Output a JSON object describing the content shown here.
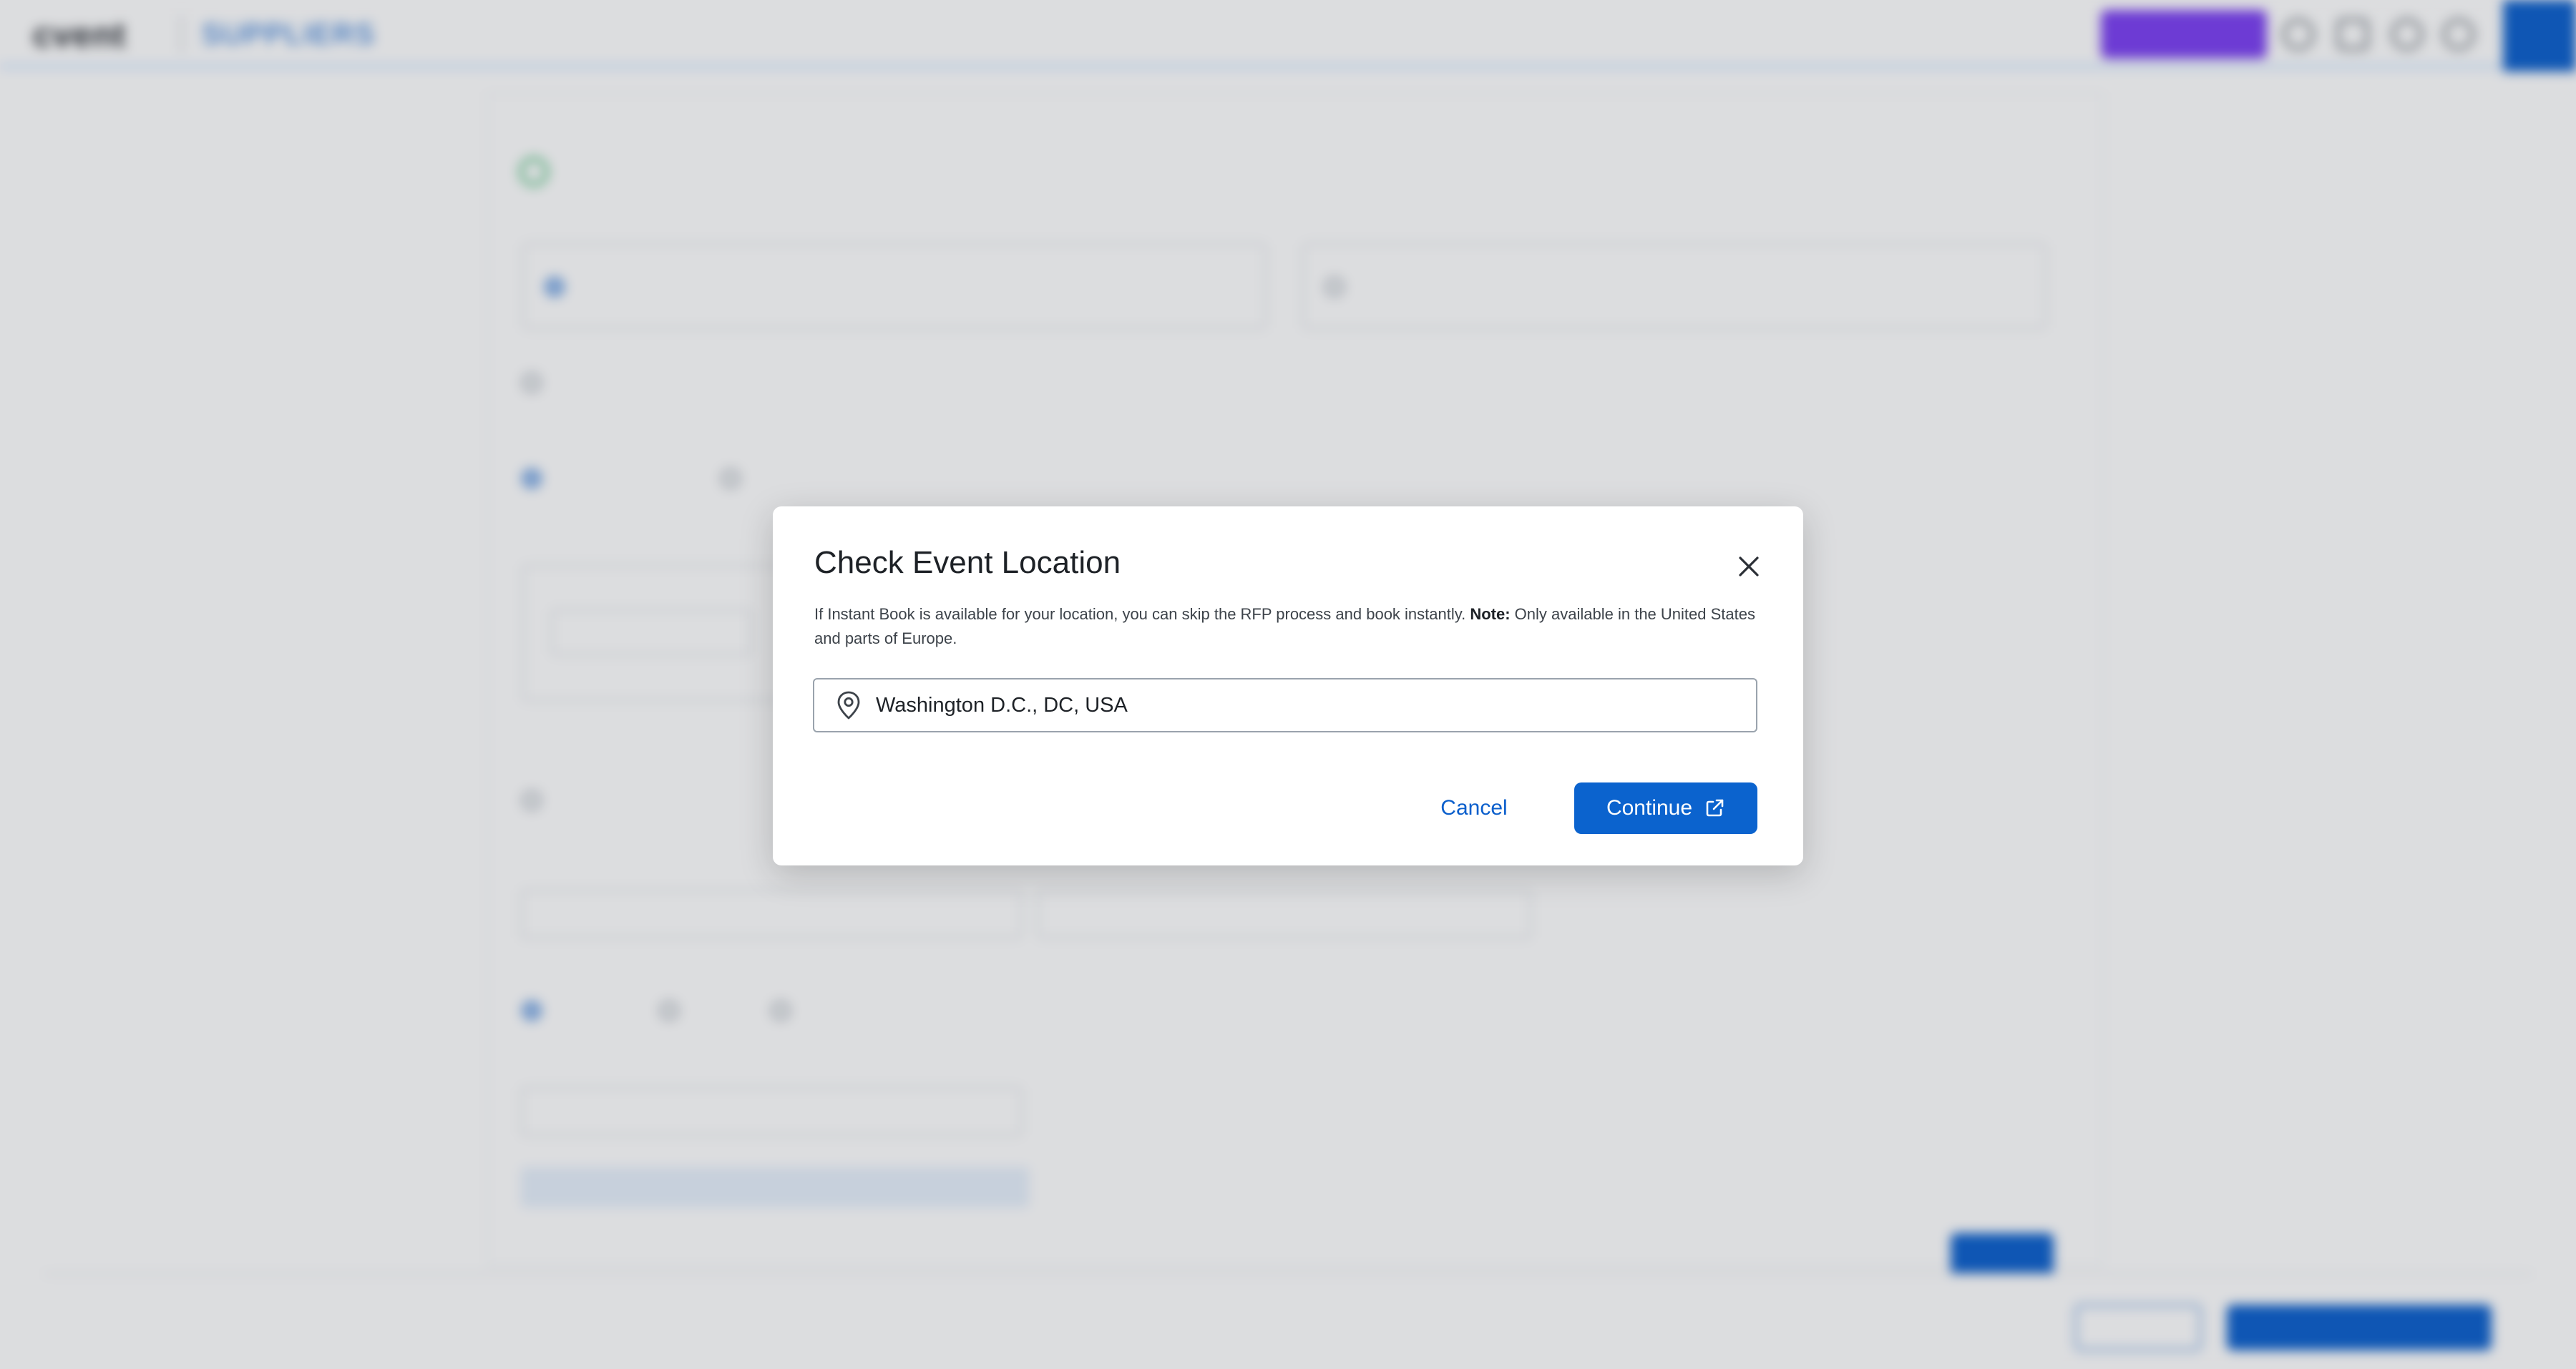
{
  "modal": {
    "title": "Check Event Location",
    "description_main": "If Instant Book is available for your location, you can skip the RFP process and book instantly. ",
    "description_note_label": "Note:",
    "description_note_text": " Only available in the United States and parts of Europe.",
    "location_value": "Washington D.C., DC, USA",
    "cancel_label": "Cancel",
    "continue_label": "Continue",
    "icons": {
      "close": "close-icon",
      "location": "location-pin-icon",
      "external": "external-link-icon"
    },
    "colors": {
      "primary": "#0b63ce",
      "link": "#0b5fcc"
    }
  }
}
